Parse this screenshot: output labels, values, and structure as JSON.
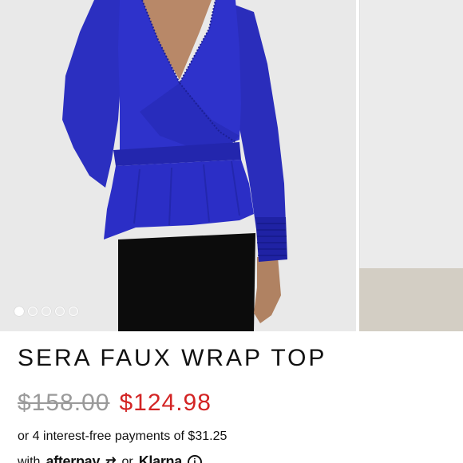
{
  "product": {
    "title": "SERA FAUX WRAP TOP",
    "original_price": "$158.00",
    "sale_price": "$124.98"
  },
  "gallery": {
    "slide_count": 5,
    "active_index": 0
  },
  "payments": {
    "installments_text": "or 4 interest-free payments of $31.25",
    "with_text": "with",
    "afterpay_label": "afterpay",
    "or_text": "or",
    "klarna_label": "Klarna",
    "info_symbol": "i"
  },
  "colors": {
    "sale_price": "#d32424",
    "original_price": "#9a9a9a",
    "garment_blue": "#2c2fc4"
  },
  "icons": {
    "afterpay_icon": "afterpay-arrows",
    "info_icon": "info-circle"
  }
}
